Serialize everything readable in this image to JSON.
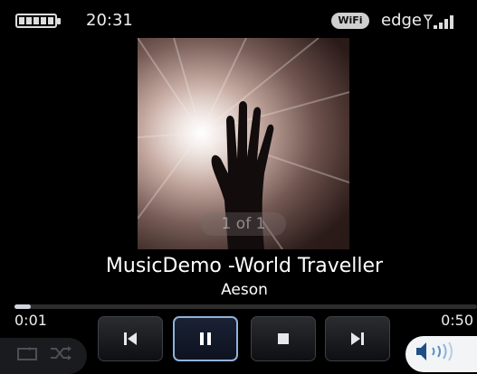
{
  "status_bar": {
    "time": "20:31",
    "wifi_label": "WiFi",
    "network_label": "edge",
    "battery_icon": "battery-full-icon",
    "signal_icon": "signal-bars-icon"
  },
  "player": {
    "track_counter": "1 of 1",
    "song_title": "MusicDemo -World Traveller",
    "artist": "Aeson",
    "elapsed": "0:01",
    "total": "0:50",
    "progress_fraction": 0.02,
    "controls": [
      {
        "name": "previous",
        "icon": "skip-previous-icon"
      },
      {
        "name": "pause",
        "icon": "pause-icon",
        "active": true
      },
      {
        "name": "stop",
        "icon": "stop-icon"
      },
      {
        "name": "next",
        "icon": "skip-next-icon"
      }
    ],
    "extra_icons": [
      "repeat-icon",
      "shuffle-icon",
      "volume-icon"
    ]
  },
  "colors": {
    "background": "#000000",
    "active_border": "#8fb2d8",
    "progress_fill": "#cfd6dc"
  }
}
